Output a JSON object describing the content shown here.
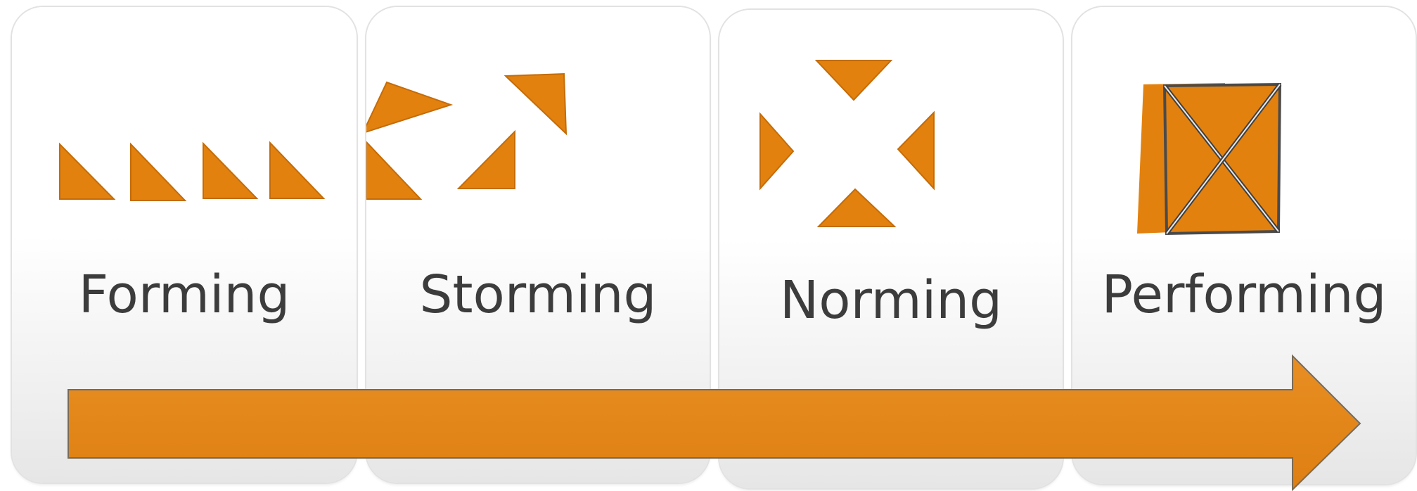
{
  "stages": [
    {
      "label": "Forming",
      "icon": "four-triangles-in-row-icon"
    },
    {
      "label": "Storming",
      "icon": "scattered-triangles-icon"
    },
    {
      "label": "Norming",
      "icon": "triangles-pointing-inward-icon"
    },
    {
      "label": "Performing",
      "icon": "square-with-diagonals-icon"
    }
  ],
  "colors": {
    "accent": "#e3810f",
    "arrow": "#e6891f",
    "arrow_border": "#7a6a55",
    "label_text": "#3c3c3c",
    "card_border": "#e2e2e2"
  }
}
